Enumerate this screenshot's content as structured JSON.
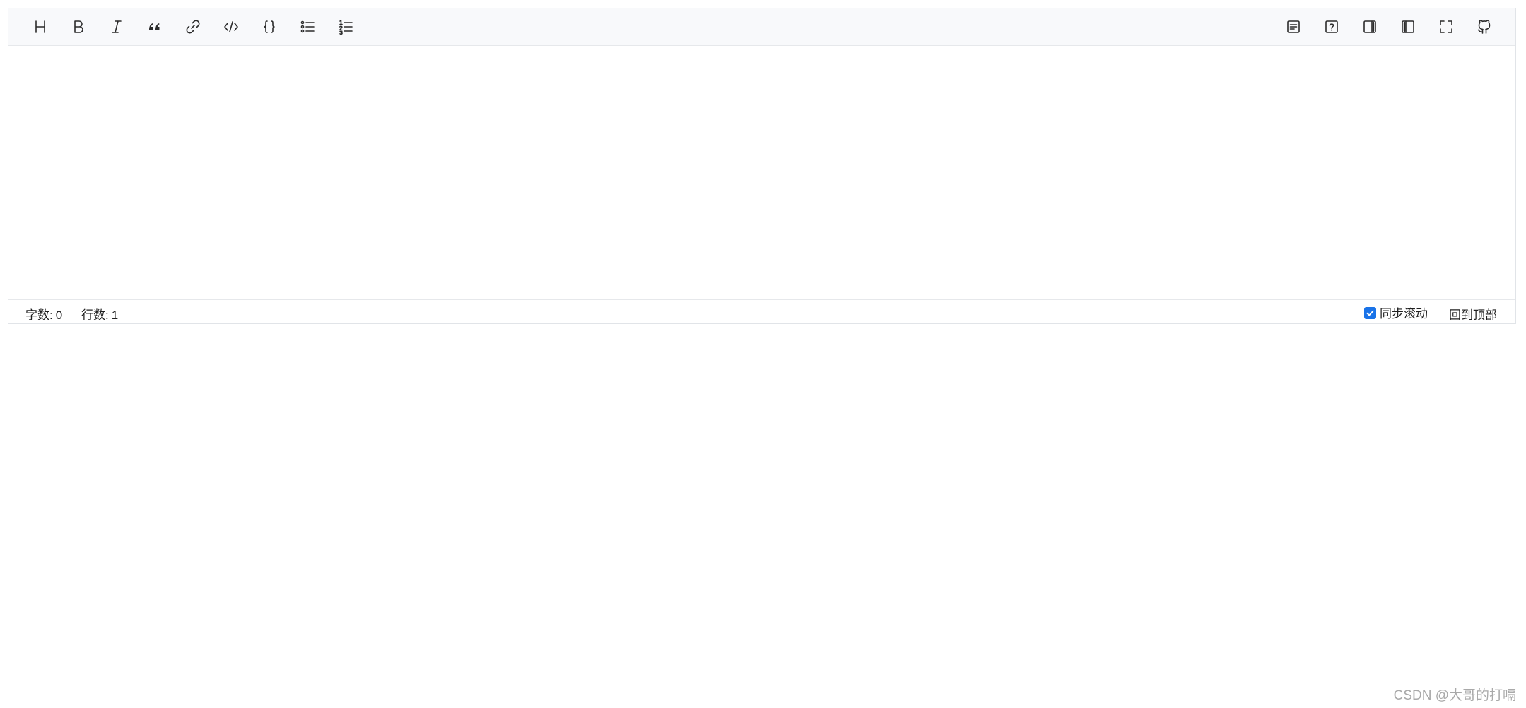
{
  "toolbar": {
    "left_buttons": [
      {
        "name": "heading-button",
        "icon": "heading-icon",
        "title": "H"
      },
      {
        "name": "bold-button",
        "icon": "bold-icon",
        "title": "B"
      },
      {
        "name": "italic-button",
        "icon": "italic-icon",
        "title": "I"
      },
      {
        "name": "quote-button",
        "icon": "quote-icon",
        "title": "“"
      },
      {
        "name": "link-button",
        "icon": "link-icon"
      },
      {
        "name": "inline-code-button",
        "icon": "code-icon"
      },
      {
        "name": "code-block-button",
        "icon": "braces-icon",
        "title": "{ }"
      },
      {
        "name": "unordered-list-button",
        "icon": "bullet-list-icon"
      },
      {
        "name": "ordered-list-button",
        "icon": "numbered-list-icon"
      }
    ],
    "right_buttons": [
      {
        "name": "toc-button",
        "icon": "document-icon"
      },
      {
        "name": "help-button",
        "icon": "help-icon",
        "title": "?"
      },
      {
        "name": "preview-only-button",
        "icon": "sidebar-right-icon"
      },
      {
        "name": "editor-only-button",
        "icon": "sidebar-left-icon"
      },
      {
        "name": "fullscreen-button",
        "icon": "fullscreen-icon"
      },
      {
        "name": "github-button",
        "icon": "github-icon"
      }
    ]
  },
  "status": {
    "word_count_label": "字数:",
    "word_count_value": "0",
    "line_count_label": "行数:",
    "line_count_value": "1",
    "sync_scroll_label": "同步滚动",
    "sync_scroll_checked": true,
    "back_to_top_label": "回到顶部"
  },
  "watermark": "CSDN @大哥的打嗝",
  "colors": {
    "toolbar_bg": "#f8f9fb",
    "border": "#e6e8eb",
    "checkbox": "#1a73e8",
    "watermark": "#a9a9a9"
  }
}
